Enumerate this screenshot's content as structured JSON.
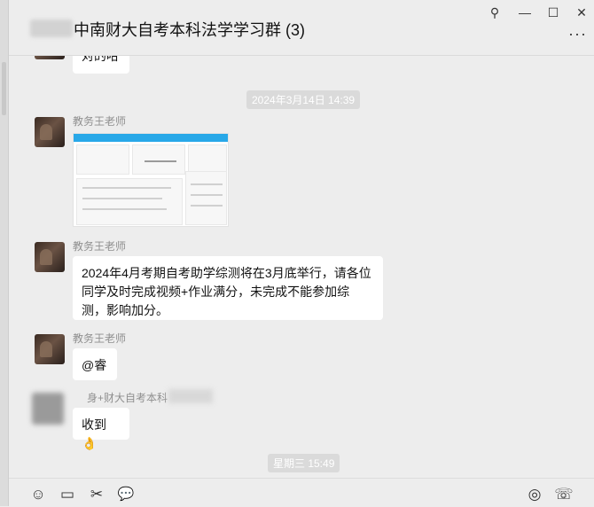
{
  "window": {
    "title": "中南财大自考本科法学学习群 (3)",
    "controls": {
      "pin_icon": "pin-icon",
      "minimize_icon": "minimize-icon",
      "maximize_icon": "maximize-icon",
      "close_icon": "close-icon"
    },
    "more_icon": "more-icon"
  },
  "icons": {
    "pin": "⚲",
    "minimize": "—",
    "maximize": "☐",
    "close": "✕",
    "more": "···",
    "emoji": "☺",
    "folder": "▭",
    "scissors": "✂",
    "chat": "💬",
    "screen": "◎",
    "call": "☏"
  },
  "messages": {
    "partial_text": "对的哈",
    "time_1": "2024年3月14日 14:39",
    "msg1_sender": "教务王老师",
    "msg2_sender": "教务王老师",
    "msg2_text": "2024年4月考期自考助学综测将在3月底举行，请各位同学及时完成视频+作业满分，未完成不能参加综测，影响加分。",
    "msg3_sender": "教务王老师",
    "msg3_text": "@睿",
    "msg4_sender": "身+财大自考本科",
    "msg4_text": "收到👌",
    "time_2": "星期三 15:49"
  },
  "toolbar": {
    "items": [
      "emoji-icon",
      "folder-icon",
      "scissors-icon",
      "chat-history-icon",
      "screen-share-icon",
      "voice-call-icon"
    ]
  }
}
